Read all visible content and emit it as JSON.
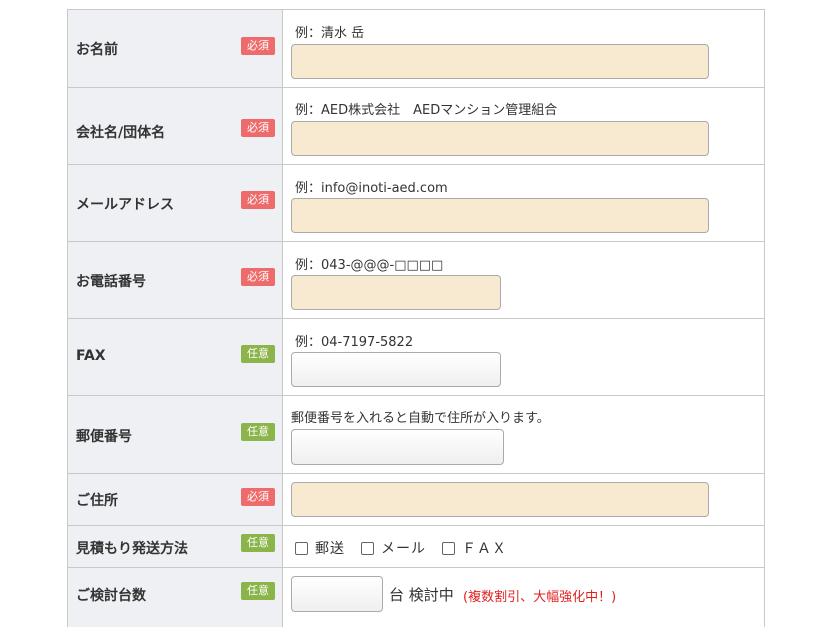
{
  "rows": [
    {
      "label": "お名前",
      "badge": "必須",
      "hint": "例：清水 岳"
    },
    {
      "label": "会社名/団体名",
      "badge": "必須",
      "hint": "例：AED株式会社　AEDマンション管理組合"
    },
    {
      "label": "メールアドレス",
      "badge": "必須",
      "hint": "例：info@inoti-aed.com"
    },
    {
      "label": "お電話番号",
      "badge": "必須",
      "hint": "例：043-@@@-□□□□"
    },
    {
      "label": "FAX",
      "badge": "任意",
      "hint": "例：04-7197-5822"
    },
    {
      "label": "郵便番号",
      "badge": "任意",
      "hint": "郵便番号を入れると自動で住所が入ります。"
    },
    {
      "label": "ご住所",
      "badge": "必須"
    },
    {
      "label": "見積もり発送方法",
      "badge": "任意",
      "options": [
        "郵送",
        "メール",
        "ＦＡＸ"
      ]
    },
    {
      "label": "ご検討台数",
      "badge": "任意",
      "unit": "台 検討中",
      "note": "(複数割引、大幅強化中！)"
    }
  ],
  "colors": {
    "required": "#ee6b6b",
    "optional": "#8bb54a",
    "required_field": "#f8e9d1",
    "label_bg": "#eef0f4"
  }
}
